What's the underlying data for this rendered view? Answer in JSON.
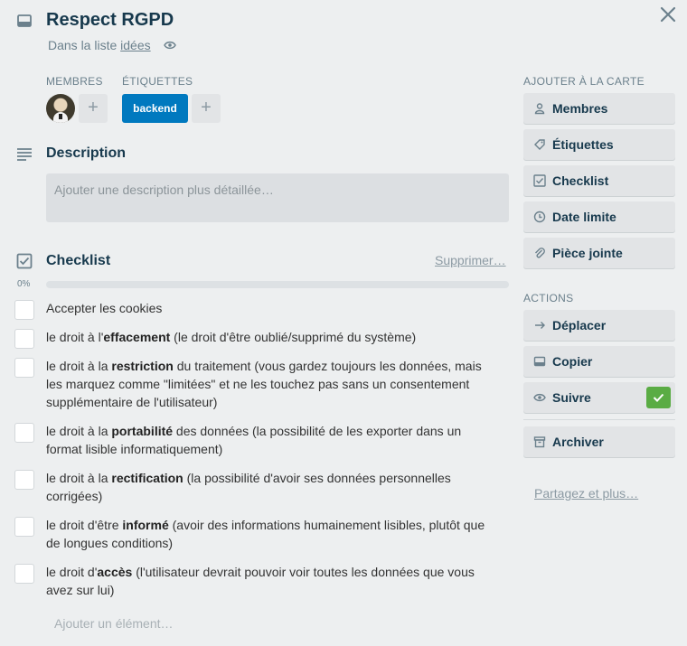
{
  "card": {
    "title": "Respect RGPD",
    "list_prefix": "Dans la liste ",
    "list_name": "idées"
  },
  "members": {
    "heading": "MEMBRES",
    "add_symbol": "+"
  },
  "labels": {
    "heading": "ÉTIQUETTES",
    "items": [
      {
        "text": "backend",
        "color": "#0079bf"
      }
    ],
    "add_symbol": "+"
  },
  "description": {
    "title": "Description",
    "placeholder": "Ajouter une description plus détaillée…"
  },
  "checklist": {
    "title": "Checklist",
    "delete_label": "Supprimer…",
    "progress_label": "0%",
    "progress": 0,
    "items": [
      {
        "checked": false,
        "parts": [
          {
            "t": "Accepter les cookies"
          }
        ]
      },
      {
        "checked": false,
        "parts": [
          {
            "t": "le droit à l'"
          },
          {
            "t": "effacement",
            "b": true
          },
          {
            "t": " (le droit d'être oublié/supprimé du système)"
          }
        ]
      },
      {
        "checked": false,
        "parts": [
          {
            "t": "le droit à la "
          },
          {
            "t": "restriction",
            "b": true
          },
          {
            "t": " du traitement (vous gardez toujours les données, mais les marquez comme \"limitées\" et ne les touchez pas sans un consentement supplémentaire de l'utilisateur)"
          }
        ]
      },
      {
        "checked": false,
        "parts": [
          {
            "t": "le droit à la "
          },
          {
            "t": "portabilité",
            "b": true
          },
          {
            "t": " des données (la possibilité de les exporter dans un format lisible informatiquement)"
          }
        ]
      },
      {
        "checked": false,
        "parts": [
          {
            "t": "le droit à la "
          },
          {
            "t": "rectification",
            "b": true
          },
          {
            "t": " (la possibilité d'avoir ses données personnelles corrigées)"
          }
        ]
      },
      {
        "checked": false,
        "parts": [
          {
            "t": "le droit d'être "
          },
          {
            "t": "informé",
            "b": true
          },
          {
            "t": " (avoir des informations humainement lisibles, plutôt que de longues conditions)"
          }
        ]
      },
      {
        "checked": false,
        "parts": [
          {
            "t": "le droit d'"
          },
          {
            "t": "accès",
            "b": true
          },
          {
            "t": " (l'utilisateur devrait pouvoir voir toutes les données que vous avez sur lui)"
          }
        ]
      }
    ],
    "add_item_placeholder": "Ajouter un élément…"
  },
  "sidebar": {
    "add_heading": "AJOUTER À LA CARTE",
    "add_buttons": [
      {
        "label": "Membres",
        "icon": "person-icon"
      },
      {
        "label": "Étiquettes",
        "icon": "tag-icon"
      },
      {
        "label": "Checklist",
        "icon": "checklist-icon"
      },
      {
        "label": "Date limite",
        "icon": "clock-icon"
      },
      {
        "label": "Pièce jointe",
        "icon": "paperclip-icon"
      }
    ],
    "actions_heading": "ACTIONS",
    "action_buttons": [
      {
        "label": "Déplacer",
        "icon": "arrow-right-icon"
      },
      {
        "label": "Copier",
        "icon": "copy-card-icon"
      },
      {
        "label": "Suivre",
        "icon": "eye-icon",
        "active": true
      }
    ],
    "archive_label": "Archiver",
    "share_label": "Partagez et plus…"
  },
  "colors": {
    "accent": "#0079bf",
    "success": "#5aac44",
    "title": "#17394d"
  }
}
